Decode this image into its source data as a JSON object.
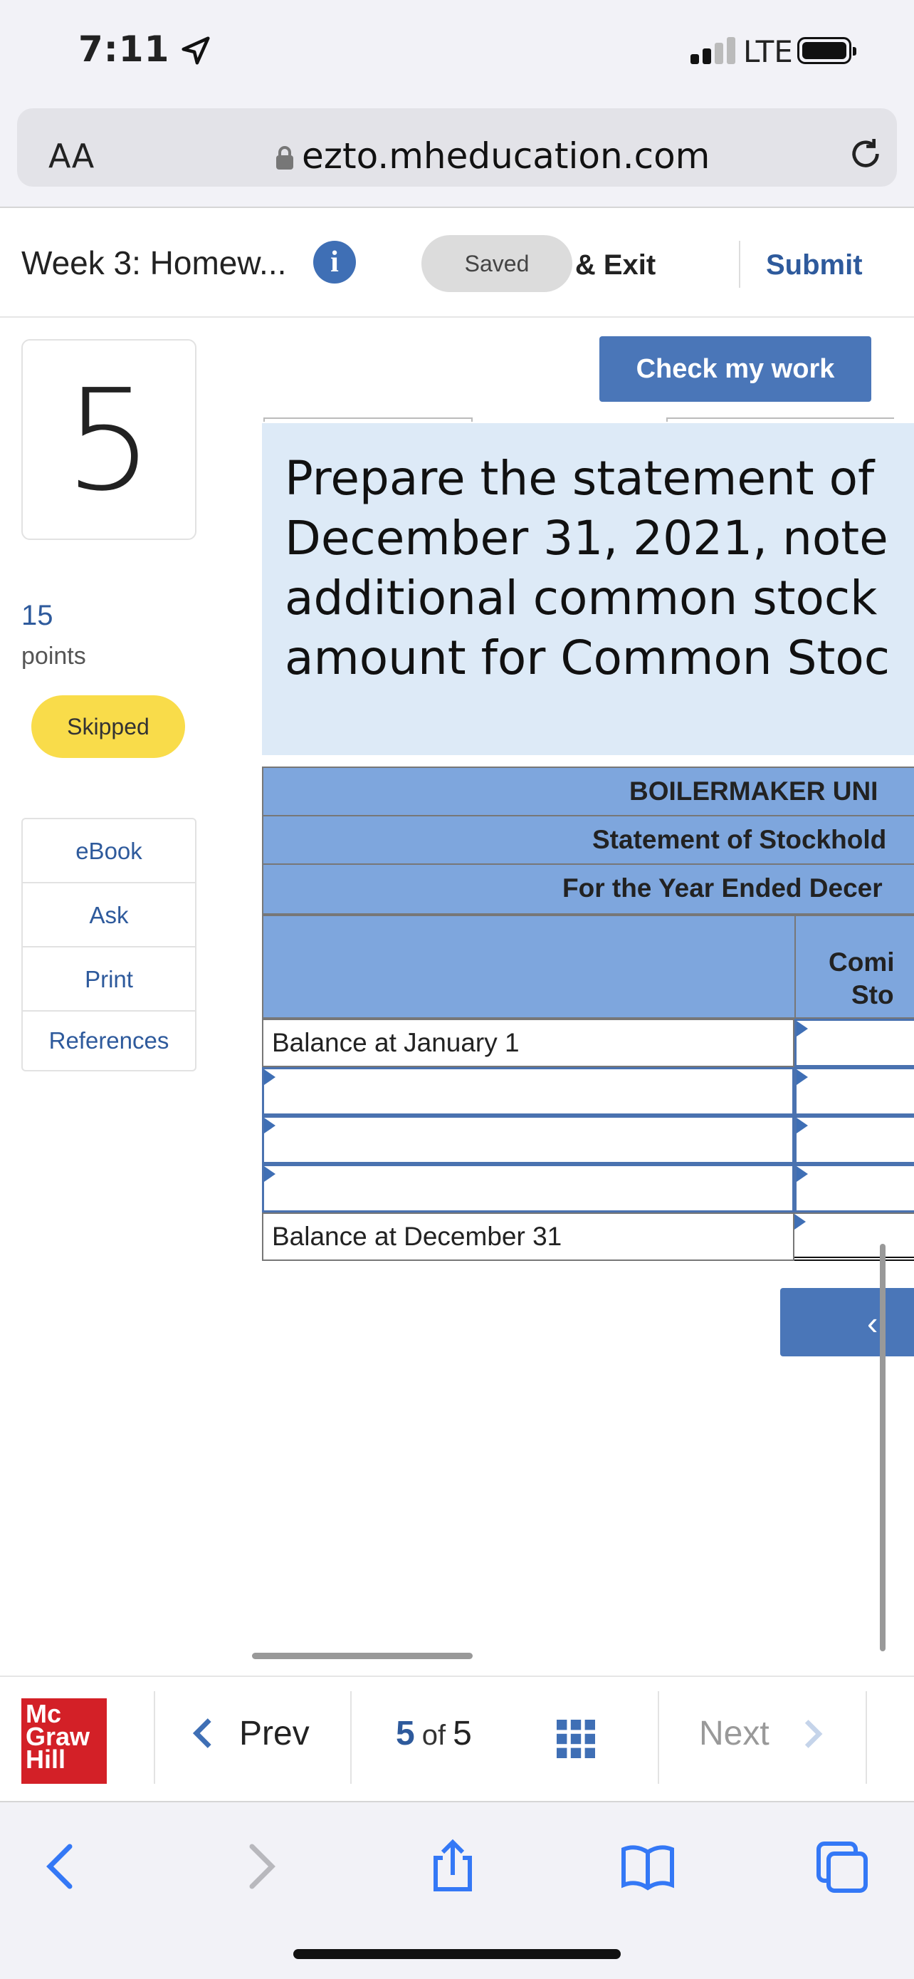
{
  "status": {
    "time": "7:11",
    "network": "LTE"
  },
  "browser": {
    "text_size_label": "AA",
    "url": "ezto.mheducation.com"
  },
  "header": {
    "assignment_title": "Week 3: Homew...",
    "saved_label": "Saved",
    "save_exit_label": "ave & Exit",
    "submit_label": "Submit"
  },
  "question": {
    "number": "5",
    "points_value": "15",
    "points_label": "points",
    "status_badge": "Skipped"
  },
  "resources": [
    "eBook",
    "Ask",
    "Print",
    "References"
  ],
  "main": {
    "check_button": "Check my work",
    "prompt_lines": [
      "Prepare the statement of",
      "December 31, 2021, note",
      "additional common stock",
      "amount for Common Stoc"
    ]
  },
  "statement": {
    "company": "BOILERMAKER UNI",
    "title": "Statement of Stockhold",
    "period": "For the Year Ended Decer",
    "column_header_line1": "Comi",
    "column_header_line2": "Sto",
    "rows": [
      {
        "label": "Balance at January 1"
      },
      {
        "label": ""
      },
      {
        "label": ""
      },
      {
        "label": ""
      },
      {
        "label": "Balance at December 31"
      }
    ],
    "nav_arrow": "‹"
  },
  "footer": {
    "logo_lines": [
      "Mc",
      "Graw",
      "Hill"
    ],
    "prev_label": "Prev",
    "current_page": "5",
    "of_label": "of",
    "total_pages": "5",
    "next_label": "Next"
  },
  "colors": {
    "accent": "#4a76b8",
    "header_blue": "#7ea6dd",
    "prompt_bg": "#ddeaf7",
    "skipped": "#f9dc4a",
    "logo_red": "#d32027"
  }
}
